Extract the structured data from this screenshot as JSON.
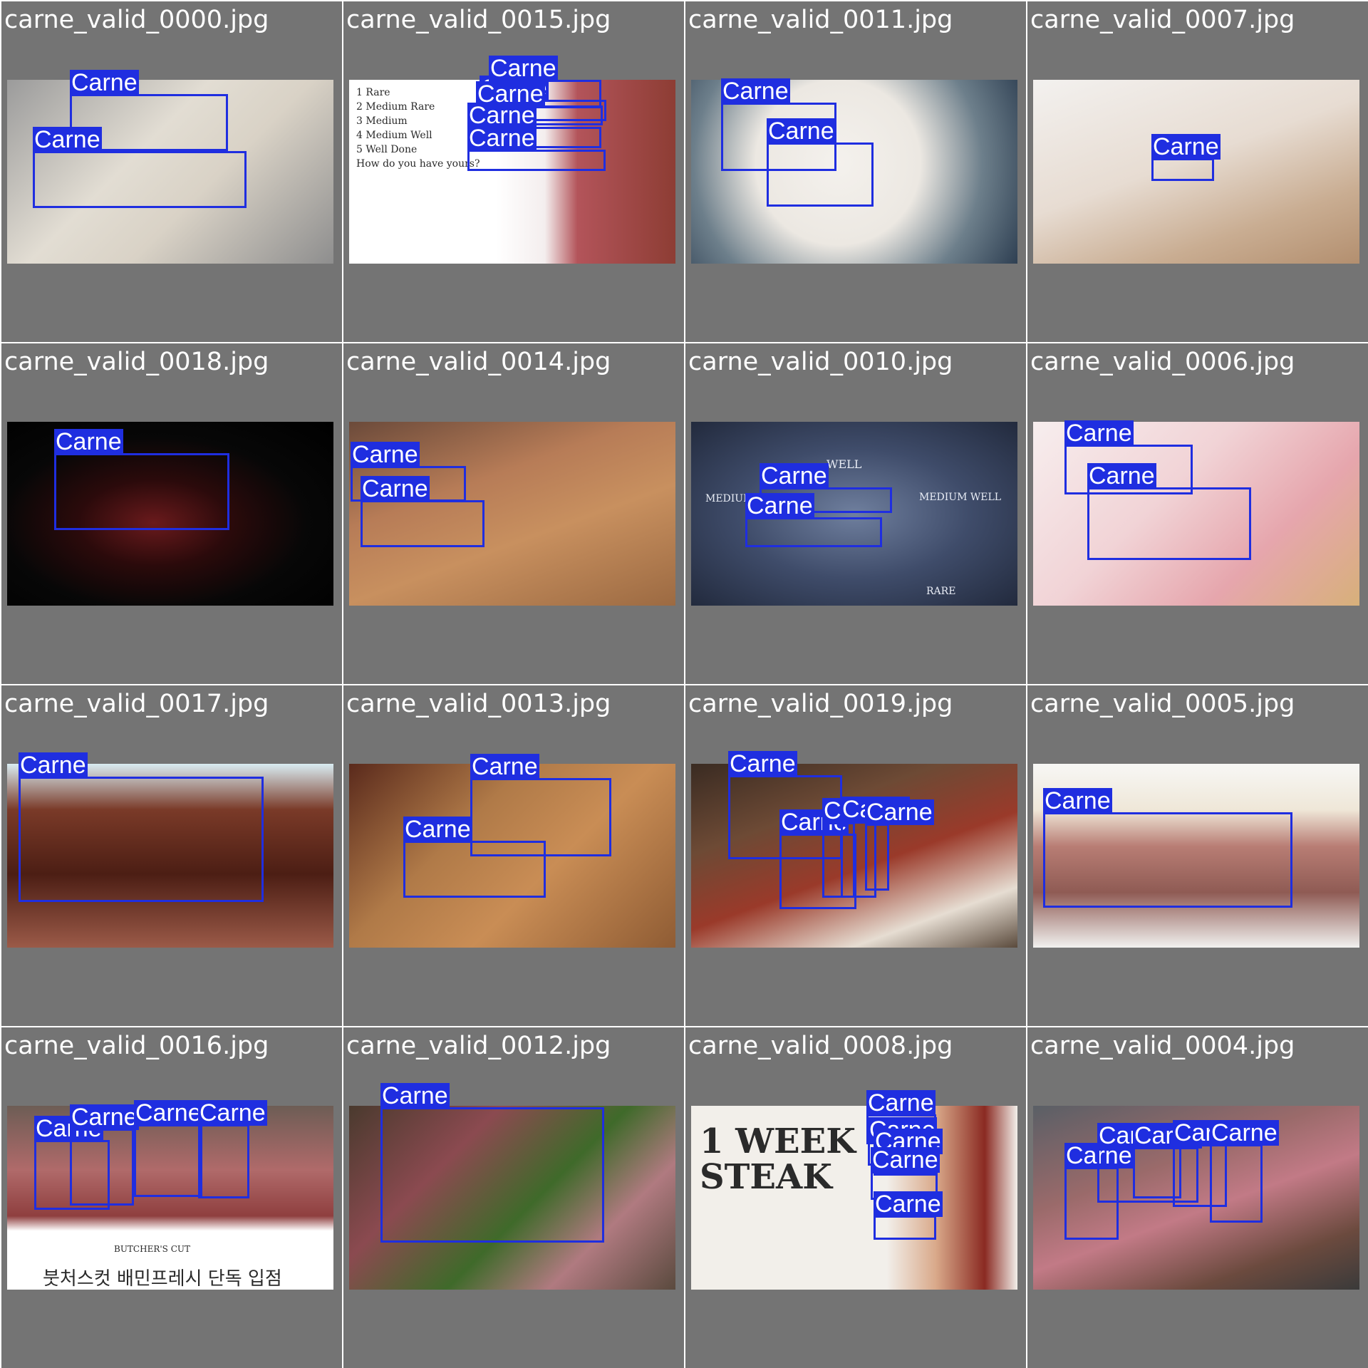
{
  "accent": "#1f2ee0",
  "tiles": [
    {
      "filename": "carne_valid_0000.jpg",
      "bg": "linear-gradient(135deg,#9b9b9b,#e2ddd3 40%,#d9d2c6 60%,#8e8e8e)",
      "captions": [],
      "detections": [
        {
          "label": "Carne"
        },
        {
          "label": "Carne"
        }
      ]
    },
    {
      "filename": "carne_valid_0015.jpg",
      "bg": "linear-gradient(90deg,#ffffff 45%,#f4eeee 60%,#b3545a 70%,#8d3d34 100%)",
      "captions": [
        "1 Rare",
        "2 Medium Rare",
        "3 Medium",
        "4 Medium Well",
        "5 Well Done",
        "How do you have yours?"
      ],
      "detections": [
        {
          "label": "Carne"
        },
        {
          "label": "Carne"
        },
        {
          "label": "Carne"
        },
        {
          "label": "Carne"
        },
        {
          "label": "Carne"
        }
      ]
    },
    {
      "filename": "carne_valid_0011.jpg",
      "bg": "radial-gradient(circle at 45% 45%,#f4f1ed 0%,#ece8e2 40%,#6d7f8b 70%,#2e3f52 100%)",
      "captions": [],
      "detections": [
        {
          "label": "Carne"
        },
        {
          "label": "Carne"
        }
      ]
    },
    {
      "filename": "carne_valid_0007.jpg",
      "bg": "linear-gradient(160deg,#f3f1ef 0%,#e7dcd2 45%,#c9ad92 75%,#b38f6f 100%)",
      "captions": [],
      "detections": [
        {
          "label": "Carne"
        }
      ]
    },
    {
      "filename": "carne_valid_0018.jpg",
      "bg": "radial-gradient(ellipse at 45% 55%,#6a1a1c 0%,#2b0a0b 30%,#070707 60%,#000000 100%)",
      "captions": [],
      "detections": [
        {
          "label": "Carne"
        }
      ]
    },
    {
      "filename": "carne_valid_0014.jpg",
      "bg": "linear-gradient(160deg,#6b4a3a 0%,#b77c57 35%,#c8905f 60%,#9c6a42 100%)",
      "captions": [],
      "detections": [
        {
          "label": "Carne"
        },
        {
          "label": "Carne"
        }
      ]
    },
    {
      "filename": "carne_valid_0010.jpg",
      "bg": "radial-gradient(ellipse at 50% 50%,#6f7f9e 0%,#3f4c6a 50%,#222a3d 100%)",
      "captions": [
        "WELL",
        "MEDIUM WELL",
        "MEDIUM RARE",
        "RARE"
      ],
      "detections": [
        {
          "label": "Carne"
        },
        {
          "label": "Carne"
        }
      ]
    },
    {
      "filename": "carne_valid_0006.jpg",
      "bg": "linear-gradient(135deg,#f7eeee 0%,#f1d3d6 40%,#e6a6ad 70%,#d7b07a 100%)",
      "captions": [],
      "detections": [
        {
          "label": "Carne"
        },
        {
          "label": "Carne"
        }
      ]
    },
    {
      "filename": "carne_valid_0017.jpg",
      "bg": "linear-gradient(180deg,#d9ecf2 0%,#7a3a28 25%,#4c1e14 60%,#9b5a48 100%)",
      "captions": [],
      "detections": [
        {
          "label": "Carne"
        }
      ]
    },
    {
      "filename": "carne_valid_0013.jpg",
      "bg": "linear-gradient(135deg,#5a2a1c 0%,#b07a48 35%,#c98d55 60%,#8f5c34 100%)",
      "captions": [],
      "detections": [
        {
          "label": "Carne"
        },
        {
          "label": "Carne"
        }
      ]
    },
    {
      "filename": "carne_valid_0019.jpg",
      "bg": "linear-gradient(160deg,#3a2b22 0%,#6d4a35 30%,#9a3a2a 55%,#e6ddd2 80%,#5a4a3c 100%)",
      "captions": [],
      "detections": [
        {
          "label": "Carne"
        },
        {
          "label": "Carne"
        },
        {
          "label": "Carne"
        },
        {
          "label": "Carne"
        },
        {
          "label": "Carne"
        }
      ]
    },
    {
      "filename": "carne_valid_0005.jpg",
      "bg": "linear-gradient(180deg,#f7f7f5 0%,#efe7d8 25%,#b87d74 45%,#8f5b54 70%,#f1f1ef 100%)",
      "captions": [],
      "detections": [
        {
          "label": "Carne"
        }
      ]
    },
    {
      "filename": "carne_valid_0016.jpg",
      "bg": "linear-gradient(180deg,#6d5d55 0%,#b06a6a 35%,#8f3f3f 60%,#ffffff 68%,#ffffff 100%)",
      "captions": [
        "BUTCHER'S CUT",
        "붓처스컷 배민프레시 단독 입점"
      ],
      "detections": [
        {
          "label": "Carne"
        },
        {
          "label": "Carne"
        },
        {
          "label": "Carne"
        },
        {
          "label": "Carne"
        }
      ]
    },
    {
      "filename": "carne_valid_0012.jpg",
      "bg": "linear-gradient(135deg,#4a3a2e 0%,#8b4a50 30%,#3f6a2a 55%,#b07a80 75%,#5a4a3e 100%)",
      "captions": [],
      "detections": [
        {
          "label": "Carne"
        }
      ]
    },
    {
      "filename": "carne_valid_0008.jpg",
      "bg": "linear-gradient(90deg,#f2efea 0%,#f2efea 60%,#d9a98a 75%,#8a2a22 90%,#f2efea 100%)",
      "captions": [
        "1 WEEK",
        "STEAK"
      ],
      "detections": [
        {
          "label": "Carne"
        },
        {
          "label": "Carne"
        },
        {
          "label": "Carne"
        },
        {
          "label": "Carne"
        },
        {
          "label": "Carne"
        }
      ]
    },
    {
      "filename": "carne_valid_0004.jpg",
      "bg": "linear-gradient(160deg,#5a5f66 0%,#9a6a6a 35%,#c27a86 55%,#6b4a3e 80%,#3a3a3a 100%)",
      "captions": [],
      "detections": [
        {
          "label": "Carne"
        },
        {
          "label": "Carne"
        },
        {
          "label": "Carne"
        },
        {
          "label": "Carne"
        },
        {
          "label": "Carne"
        }
      ]
    }
  ]
}
